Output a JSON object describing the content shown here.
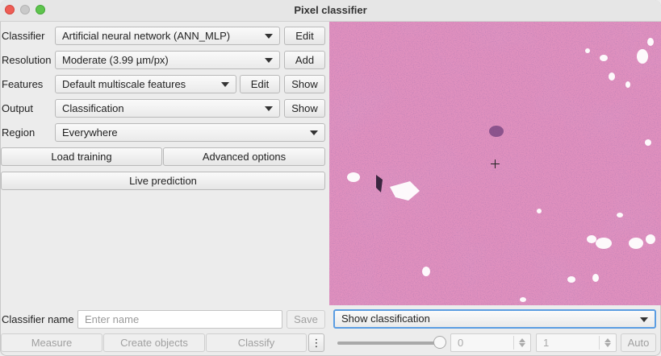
{
  "window": {
    "title": "Pixel classifier"
  },
  "rows": {
    "classifier": {
      "label": "Classifier",
      "value": "Artificial neural network (ANN_MLP)",
      "edit": "Edit"
    },
    "resolution": {
      "label": "Resolution",
      "value": "Moderate (3.99 µm/px)",
      "add": "Add"
    },
    "features": {
      "label": "Features",
      "value": "Default multiscale features",
      "edit": "Edit",
      "show": "Show"
    },
    "output": {
      "label": "Output",
      "value": "Classification",
      "show": "Show"
    },
    "region": {
      "label": "Region",
      "value": "Everywhere"
    }
  },
  "buttons": {
    "load_training": "Load training",
    "advanced_options": "Advanced options",
    "live_prediction": "Live prediction"
  },
  "bottom": {
    "classifier_name_label": "Classifier name",
    "classifier_name_placeholder": "Enter name",
    "save": "Save",
    "display_mode": "Show classification",
    "measure": "Measure",
    "create_objects": "Create objects",
    "classify": "Classify",
    "more": "⋮",
    "opacity": 1.0,
    "min_value": "0",
    "max_value": "1",
    "auto": "Auto"
  },
  "colors": {
    "tissue_bg": "#d97fb0",
    "focus_ring": "#5b9de2"
  }
}
